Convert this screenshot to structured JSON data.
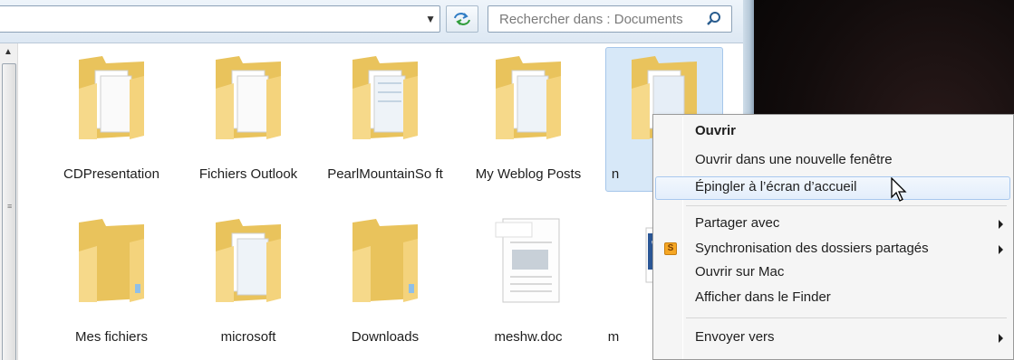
{
  "toolbar": {
    "address_value": "",
    "search_placeholder": "Rechercher dans : Documents"
  },
  "items_row1": [
    {
      "label": "CDPresentation",
      "type": "folder-docs"
    },
    {
      "label": "Fichiers Outlook",
      "type": "folder-docs"
    },
    {
      "label": "PearlMountainSo ft",
      "type": "folder-docs"
    },
    {
      "label": "My Weblog Posts",
      "type": "folder-docs"
    },
    {
      "label": "n",
      "type": "folder-docs"
    }
  ],
  "items_row2": [
    {
      "label": "Mes fichiers",
      "type": "folder"
    },
    {
      "label": "microsoft",
      "type": "folder-docs"
    },
    {
      "label": "Downloads",
      "type": "folder"
    },
    {
      "label": "meshw.doc",
      "type": "document"
    },
    {
      "label": "m",
      "type": "word-doc"
    }
  ],
  "context_menu": {
    "open": "Ouvrir",
    "open_new_window": "Ouvrir dans une nouvelle fenêtre",
    "pin_start": "Épingler à l’écran d’accueil",
    "share_with": "Partager avec",
    "sync_shared": "Synchronisation des dossiers partagés",
    "open_on_mac": "Ouvrir sur Mac",
    "show_in_finder": "Afficher dans le Finder",
    "send_to": "Envoyer vers"
  },
  "colors": {
    "folder_yellow": "#f3d37a",
    "selection_blue": "#d7e8f8",
    "menu_highlight": "#a8c8ee"
  }
}
